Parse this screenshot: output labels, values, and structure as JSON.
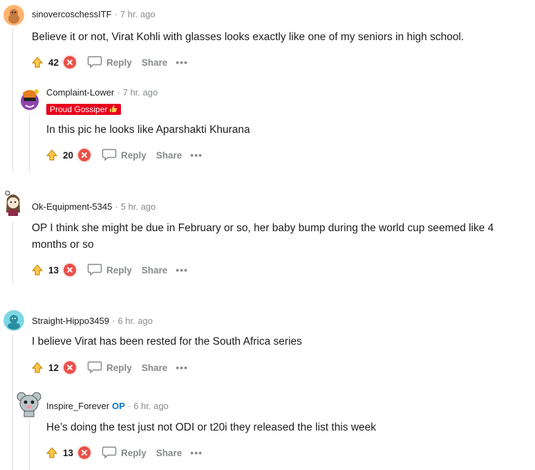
{
  "comments": [
    {
      "author": "sinovercoschessITF",
      "time": "7 hr. ago",
      "body": "Believe it or not, Virat Kohli with glasses looks exactly like one of my seniors in high school.",
      "score": "42",
      "reply": "Reply",
      "share": "Share",
      "more": "•••"
    },
    {
      "author": "Complaint-Lower",
      "time": "7 hr. ago",
      "flair": "Proud Gossiper",
      "body": "In this pic he looks like Aparshakti Khurana",
      "score": "20",
      "reply": "Reply",
      "share": "Share",
      "more": "•••"
    },
    {
      "author": "Ok-Equipment-5345",
      "time": "5 hr. ago",
      "body": "OP I think she might be due in February or so, her baby bump during the world cup seemed like 4 months or so",
      "score": "13",
      "reply": "Reply",
      "share": "Share",
      "more": "•••"
    },
    {
      "author": "Straight-Hippo3459",
      "time": "6 hr. ago",
      "body": "I believe Virat has been rested for the South Africa series",
      "score": "12",
      "reply": "Reply",
      "share": "Share",
      "more": "•••"
    },
    {
      "author": "Inspire_Forever",
      "op_tag": "OP",
      "time": "6 hr. ago",
      "body": "He’s doing the test just not ODI or t20i they released the list this week",
      "score": "13",
      "reply": "Reply",
      "share": "Share",
      "more": "•••"
    }
  ],
  "separator": "·",
  "colors": {
    "downvote": "#ea4f49",
    "flair_bg": "#e8001c",
    "op_tag": "#0079d3",
    "muted": "#878a8c"
  },
  "icons": [
    "upvote-icon",
    "downvote-icon",
    "reply-icon",
    "more-icon",
    "thumbs-up-icon"
  ]
}
